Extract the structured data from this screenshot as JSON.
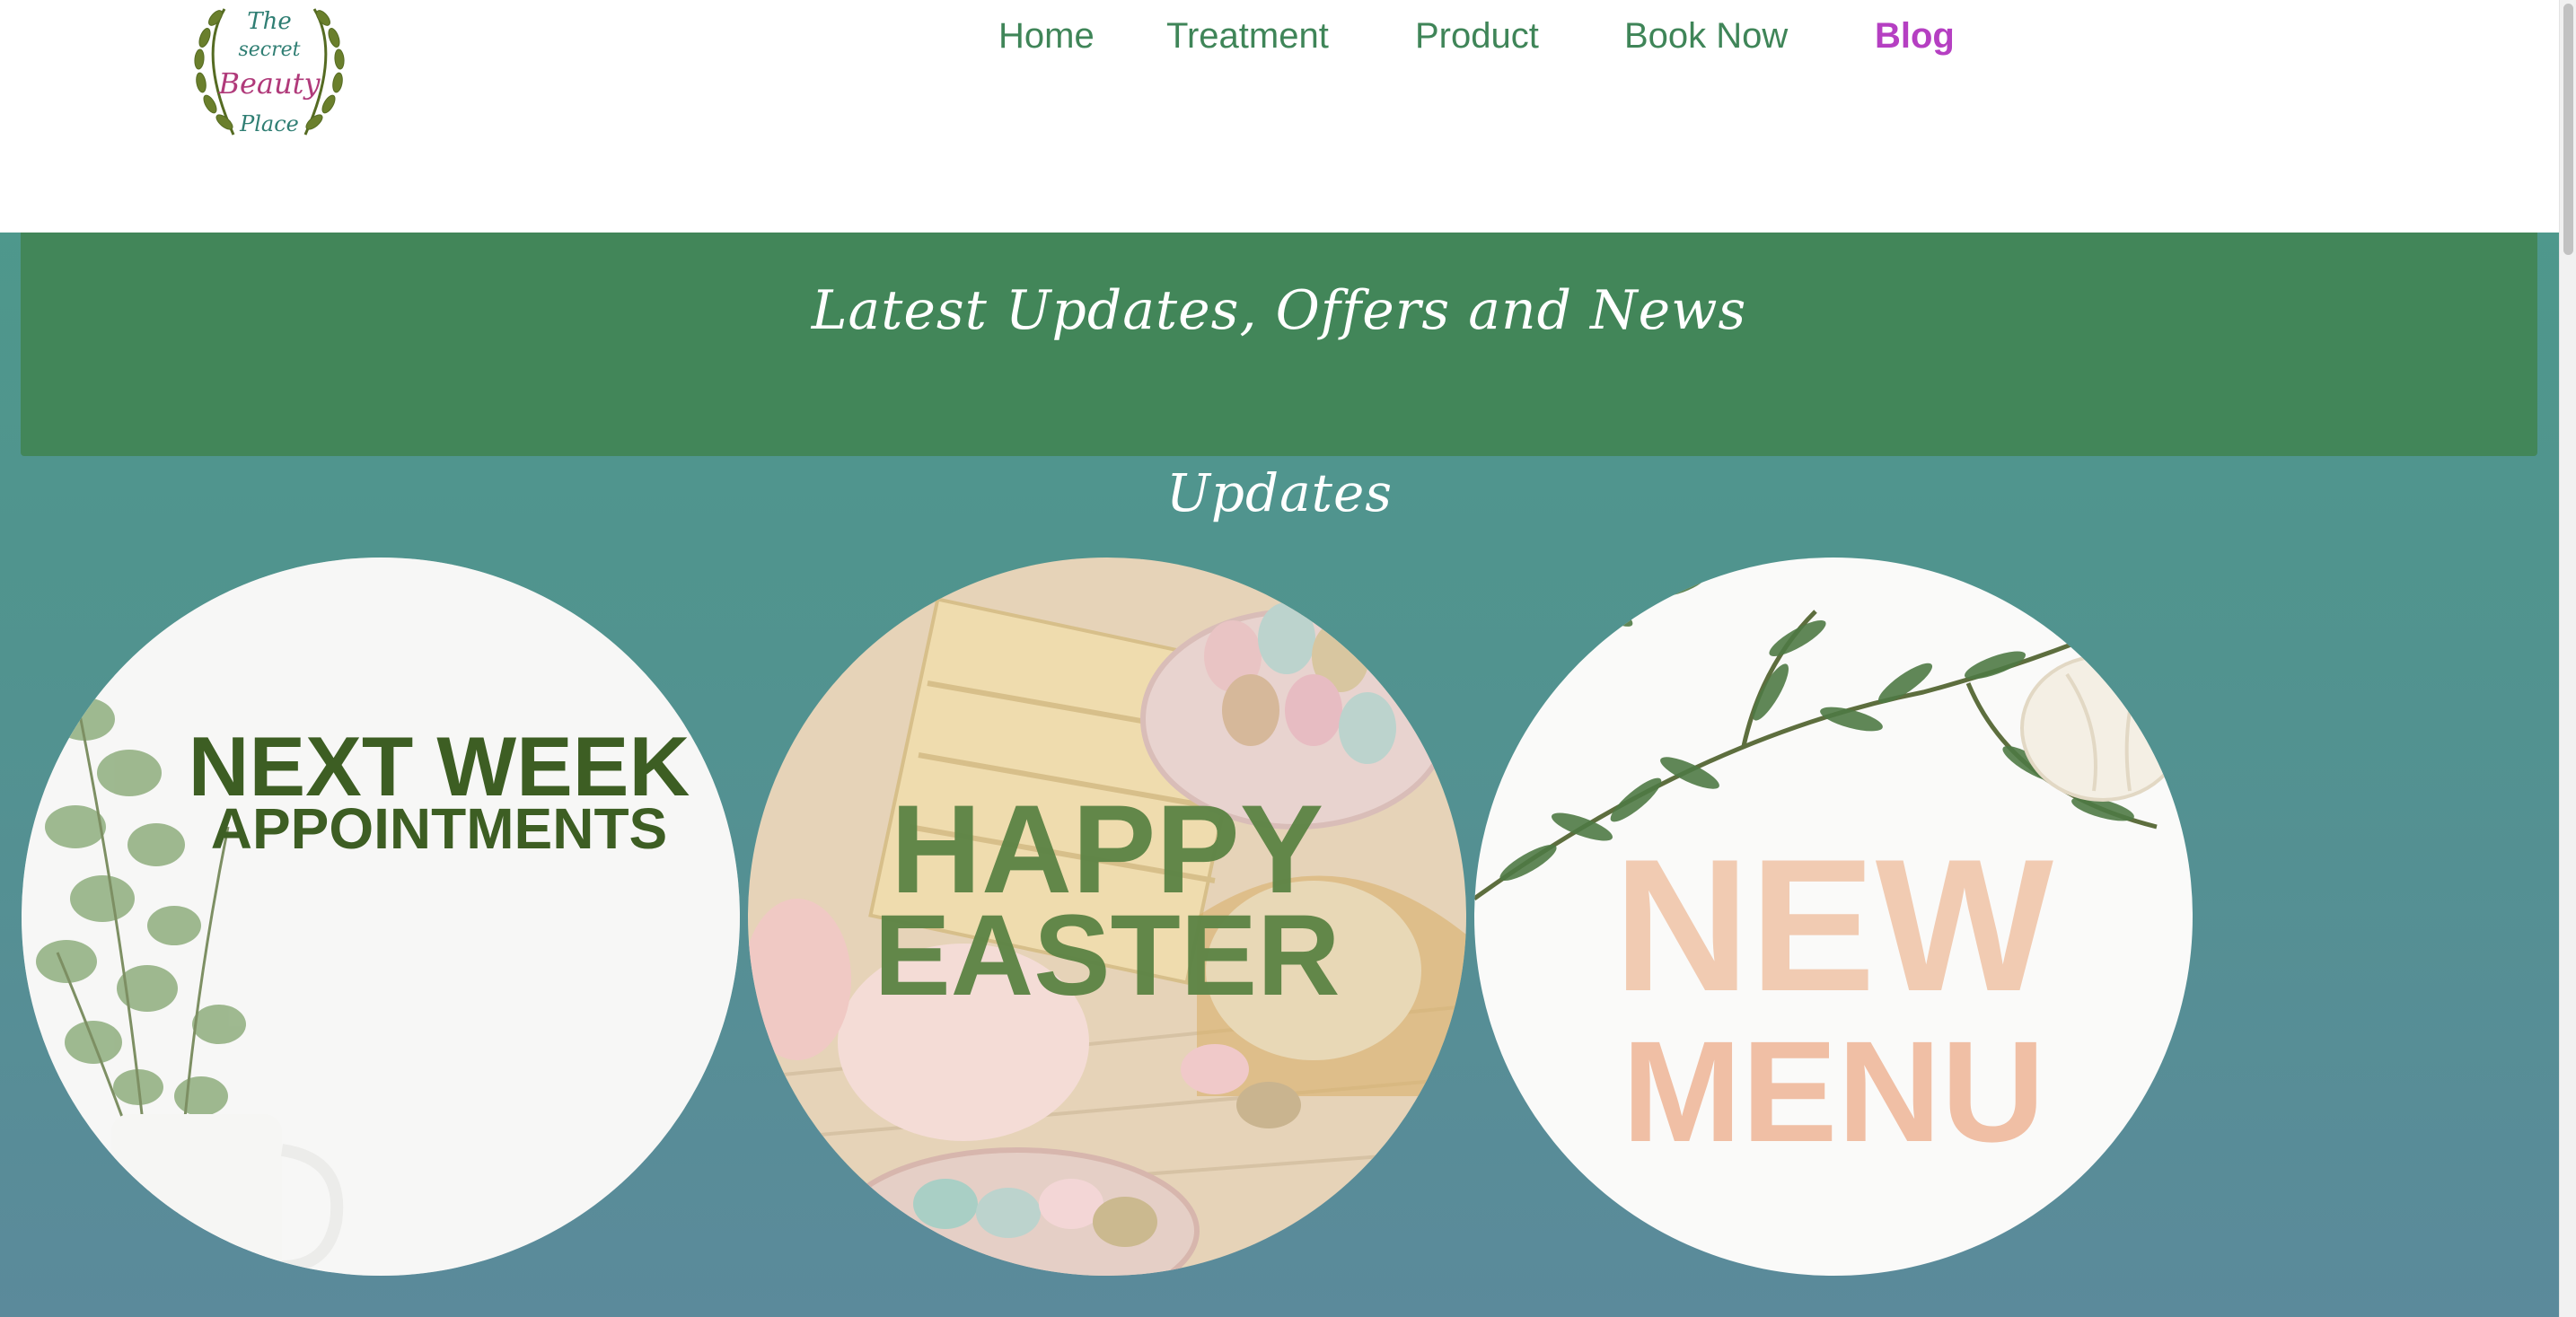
{
  "logo": {
    "line1": "The",
    "line2": "secret",
    "line3": "Beauty",
    "line4": "Place"
  },
  "nav": {
    "items": [
      {
        "label": "Home",
        "active": false
      },
      {
        "label": "Treatment",
        "active": false
      },
      {
        "label": "Product",
        "active": false
      },
      {
        "label": "Book Now",
        "active": false
      },
      {
        "label": "Blog",
        "active": true
      }
    ]
  },
  "banner": {
    "title": "Latest Updates, Offers and News"
  },
  "updates": {
    "title": "Updates",
    "cards": [
      {
        "line1": "NEXT WEEK",
        "line2": "APPOINTMENTS",
        "icon": "eucalyptus-plant-image"
      },
      {
        "line1": "HAPPY",
        "line2": "EASTER",
        "icon": "easter-eggs-image"
      },
      {
        "line1": "NEW",
        "line2": "MENU",
        "icon": "olive-branch-image"
      }
    ]
  },
  "colors": {
    "nav_text": "#3f8558",
    "nav_active": "#b53fc2",
    "banner_bg": "#428659",
    "page_bg_top": "#4d9a8a",
    "page_bg_bottom": "#5b8a9b"
  }
}
